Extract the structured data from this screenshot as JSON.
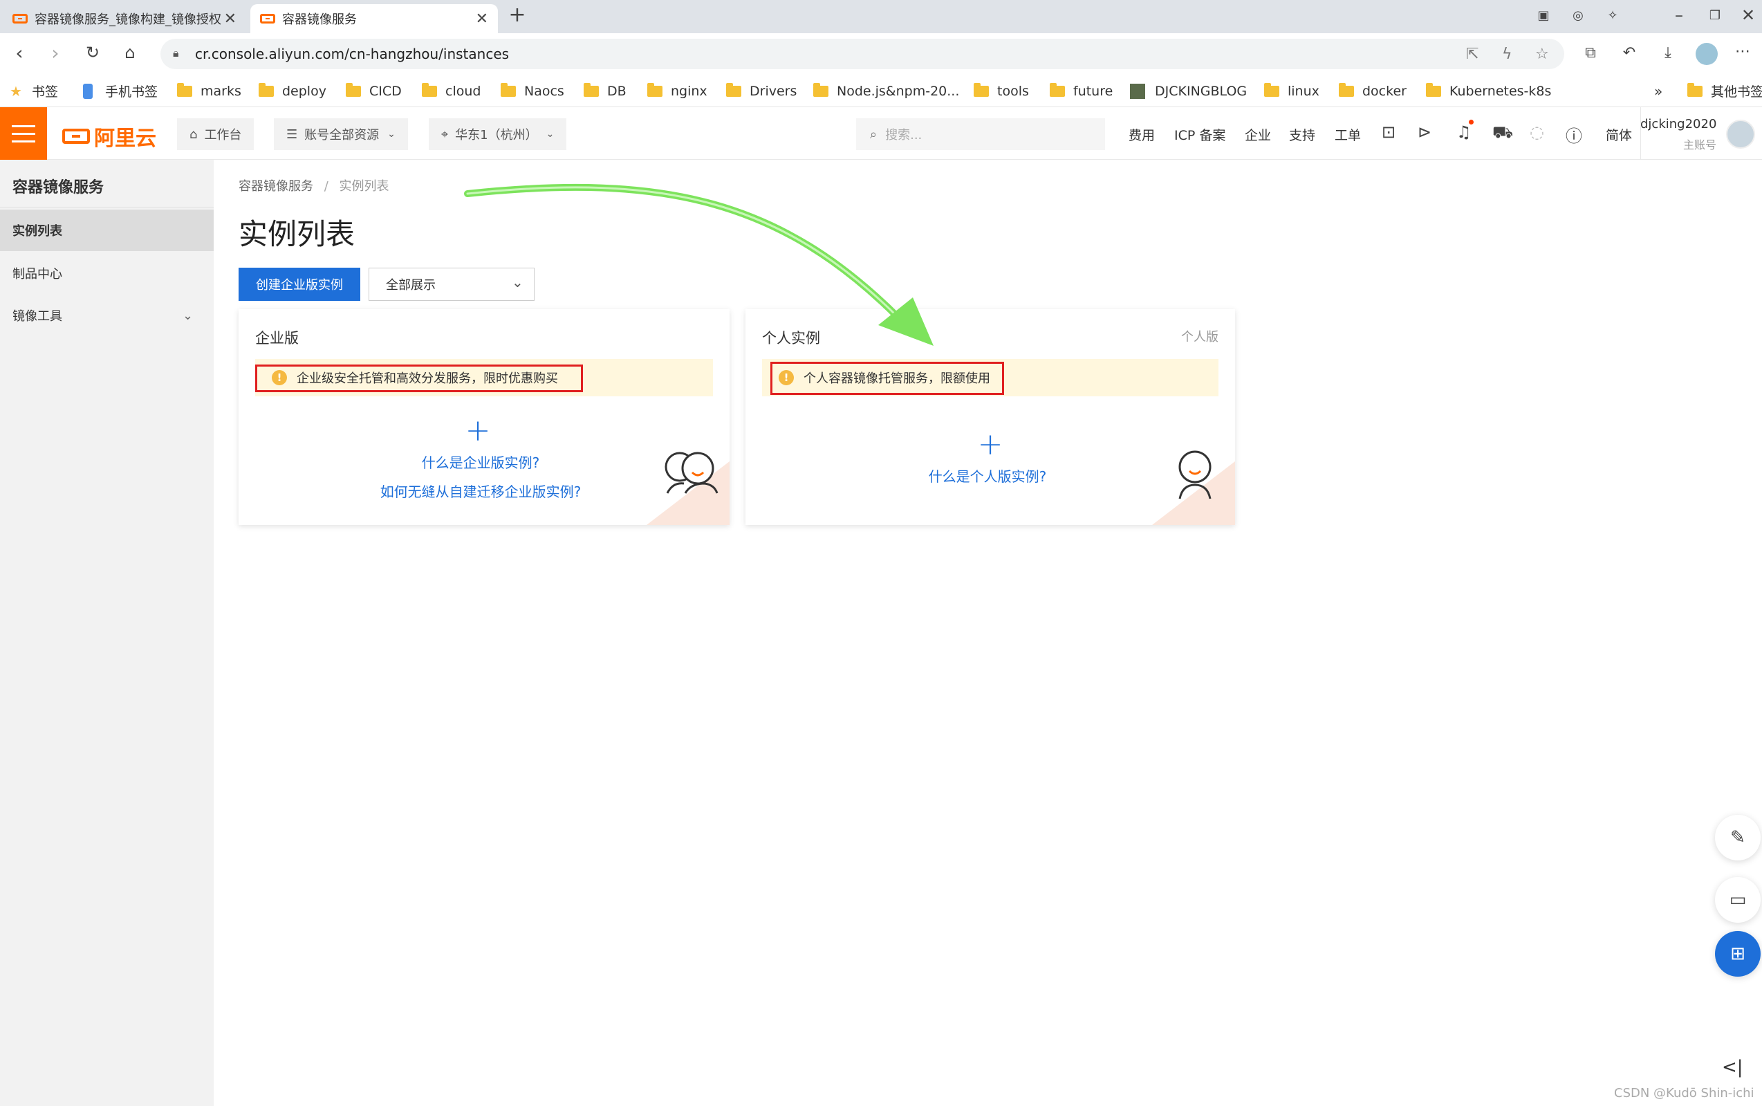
{
  "browser": {
    "tabs": [
      {
        "title": "容器镜像服务_镜像构建_镜像授权"
      },
      {
        "title": "容器镜像服务"
      }
    ],
    "url": "cr.console.aliyun.com/cn-hangzhou/instances",
    "bookmarks": [
      "书签",
      "手机书签",
      "marks",
      "deploy",
      "CICD",
      "cloud",
      "Naocs",
      "DB",
      "nginx",
      "Drivers",
      "Node.js&npm-20...",
      "tools",
      "future",
      "DJCKINGBLOG",
      "linux",
      "docker",
      "Kubernetes-k8s",
      "其他书签"
    ]
  },
  "console": {
    "logo": "阿里云",
    "workbench": "工作台",
    "resources": "账号全部资源",
    "region": "华东1（杭州）",
    "search_placeholder": "搜索...",
    "links": [
      "费用",
      "ICP 备案",
      "企业",
      "支持",
      "工单"
    ],
    "lang": "简体",
    "username": "djcking2020",
    "account_type": "主账号"
  },
  "sidebar": {
    "title": "容器镜像服务",
    "items": [
      "实例列表",
      "制品中心",
      "镜像工具"
    ]
  },
  "main": {
    "breadcrumb": [
      "容器镜像服务",
      "实例列表"
    ],
    "breadcrumb_sep": "/",
    "page_title": "实例列表",
    "create_button": "创建企业版实例",
    "filter_select": "全部展示",
    "cards": [
      {
        "title": "企业版",
        "tag": "",
        "notice": "企业级安全托管和高效分发服务，限时优惠购买",
        "links": [
          "什么是企业版实例?",
          "如何无缝从自建迁移企业版实例?"
        ]
      },
      {
        "title": "个人实例",
        "tag": "个人版",
        "notice": "个人容器镜像托管服务，限额使用",
        "links": [
          "什么是个人版实例?"
        ]
      }
    ]
  },
  "watermark": "CSDN @Kudō Shin-ichi",
  "colors": {
    "brand": "#ff6a00",
    "primary": "#1e6fd9",
    "annotation": "#e02020",
    "arrow": "#7de35c"
  }
}
